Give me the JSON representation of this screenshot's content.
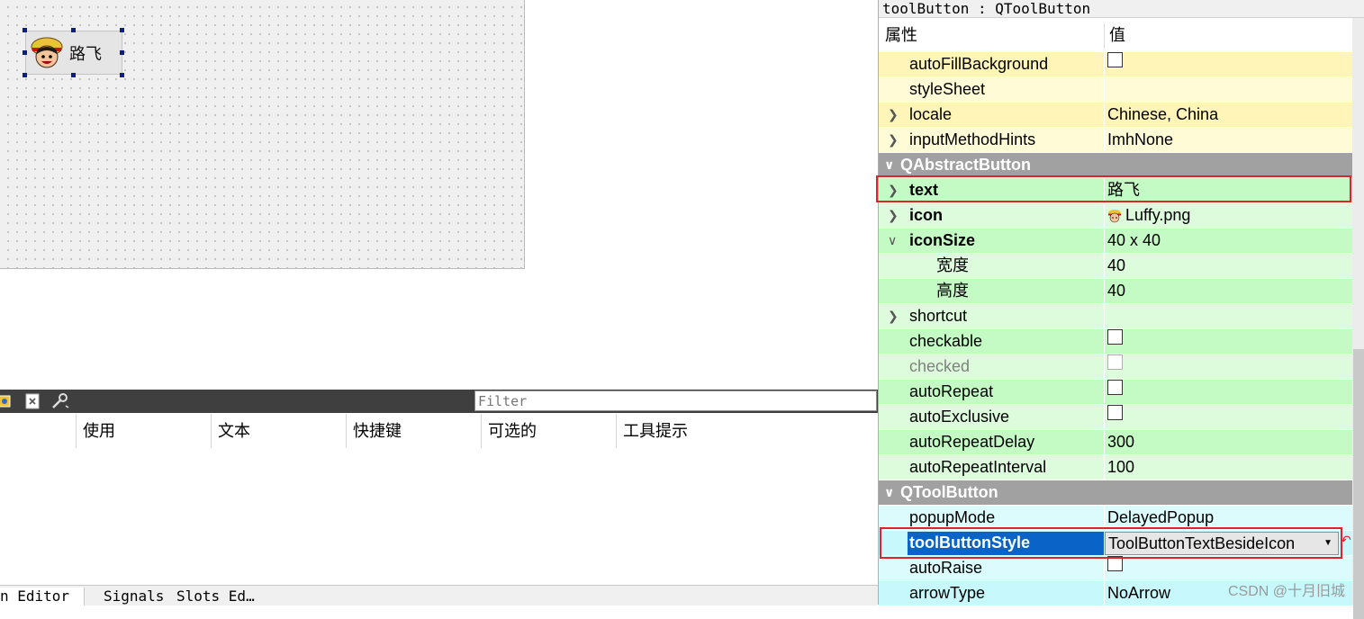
{
  "form": {
    "tool_button_text": "路飞"
  },
  "action_editor": {
    "filter_placeholder": "Filter",
    "columns": [
      "使用",
      "文本",
      "快捷键",
      "可选的",
      "工具提示"
    ],
    "tabs": [
      "n Editor",
      "Signals",
      "Slots Ed…"
    ]
  },
  "property_editor": {
    "title": "toolButton : QToolButton",
    "header_property": "属性",
    "header_value": "值",
    "rows": [
      {
        "name": "autoFillBackground",
        "value": ""
      },
      {
        "name": "styleSheet",
        "value": ""
      },
      {
        "name": "locale",
        "value": "Chinese, China"
      },
      {
        "name": "inputMethodHints",
        "value": "ImhNone"
      },
      {
        "name": "QAbstractButton",
        "value": ""
      },
      {
        "name": "text",
        "value": "路飞"
      },
      {
        "name": "icon",
        "value": "Luffy.png"
      },
      {
        "name": "iconSize",
        "value": "40 x 40"
      },
      {
        "name": "宽度",
        "value": "40"
      },
      {
        "name": "高度",
        "value": "40"
      },
      {
        "name": "shortcut",
        "value": ""
      },
      {
        "name": "checkable",
        "value": ""
      },
      {
        "name": "checked",
        "value": ""
      },
      {
        "name": "autoRepeat",
        "value": ""
      },
      {
        "name": "autoExclusive",
        "value": ""
      },
      {
        "name": "autoRepeatDelay",
        "value": "300"
      },
      {
        "name": "autoRepeatInterval",
        "value": "100"
      },
      {
        "name": "QToolButton",
        "value": ""
      },
      {
        "name": "popupMode",
        "value": "DelayedPopup"
      },
      {
        "name": "toolButtonStyle",
        "value": "ToolButtonTextBesideIcon"
      },
      {
        "name": "autoRaise",
        "value": ""
      },
      {
        "name": "arrowType",
        "value": "NoArrow"
      }
    ]
  },
  "watermark": "CSDN @十月旧城",
  "colors": {
    "selection": "#0a64c8",
    "highlight_box": "#e0232a",
    "group_header": "#a1a1a1",
    "qwidget_rows": "#fff5b8",
    "qabstractbutton_rows": "#c4fbc4",
    "qtoolbutton_rows": "#c6f8fc"
  }
}
